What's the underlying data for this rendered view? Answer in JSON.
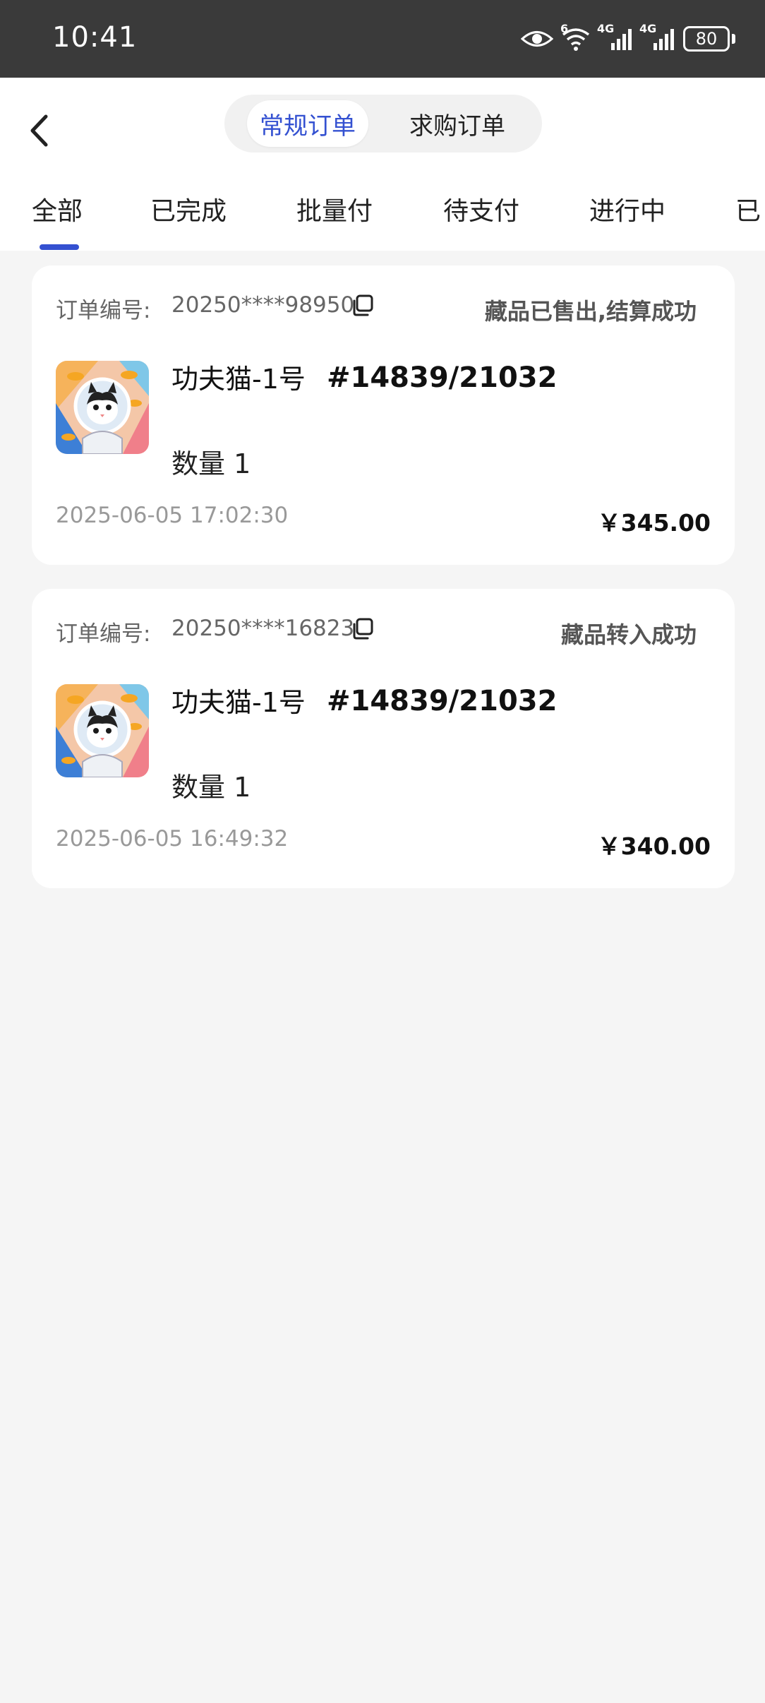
{
  "status_bar": {
    "time": "10:41",
    "wifi_badge": "6",
    "signal1_label": "4G",
    "signal2_label": "4G",
    "battery": "80"
  },
  "header": {
    "segments": [
      "常规订单",
      "求购订单"
    ],
    "active_segment": 0
  },
  "tabs": [
    "全部",
    "已完成",
    "批量付",
    "待支付",
    "进行中",
    "已"
  ],
  "active_tab": 0,
  "orders": [
    {
      "order_label": "订单编号:",
      "order_number": "20250****98950",
      "status": "藏品已售出,结算成功",
      "product_name": "功夫猫-1号",
      "serial": "#14839/21032",
      "quantity": "数量 1",
      "date": "2025-06-05 17:02:30",
      "price": "￥345.00"
    },
    {
      "order_label": "订单编号:",
      "order_number": "20250****16823",
      "status": "藏品转入成功",
      "product_name": "功夫猫-1号",
      "serial": "#14839/21032",
      "quantity": "数量 1",
      "date": "2025-06-05 16:49:32",
      "price": "￥340.00"
    }
  ],
  "colors": {
    "accent": "#3451d1",
    "status_bar": "#3a3a3a",
    "background": "#f5f5f5"
  }
}
